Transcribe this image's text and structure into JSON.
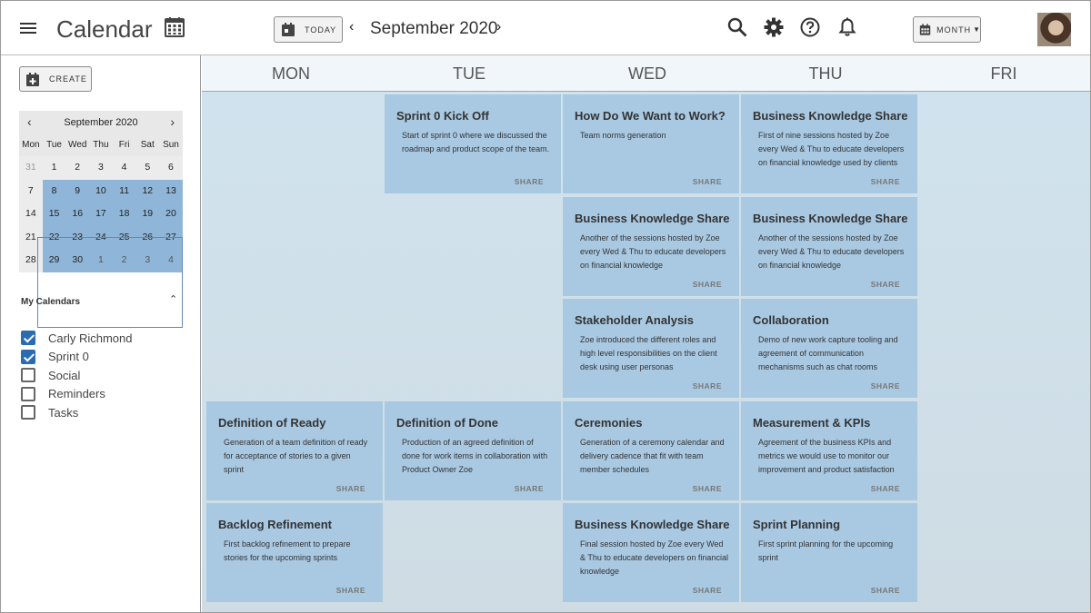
{
  "header": {
    "title": "Calendar",
    "today_label": "TODAY",
    "month_label": "September 2020",
    "view_label": "MONTH"
  },
  "sidebar": {
    "create_label": "CREATE",
    "mini_calendar": {
      "title": "September 2020",
      "dow": [
        "Mon",
        "Tue",
        "Wed",
        "Thu",
        "Fri",
        "Sat",
        "Sun"
      ],
      "weeks": [
        [
          "31",
          "1",
          "2",
          "3",
          "4",
          "5",
          "6"
        ],
        [
          "7",
          "8",
          "9",
          "10",
          "11",
          "12",
          "13"
        ],
        [
          "14",
          "15",
          "16",
          "17",
          "18",
          "19",
          "20"
        ],
        [
          "21",
          "22",
          "23",
          "24",
          "25",
          "26",
          "27"
        ],
        [
          "28",
          "29",
          "30",
          "1",
          "2",
          "3",
          "4"
        ]
      ]
    },
    "my_calendars_title": "My Calendars",
    "calendars": [
      {
        "name": "Carly Richmond",
        "checked": true
      },
      {
        "name": "Sprint 0",
        "checked": true
      },
      {
        "name": "Social",
        "checked": false
      },
      {
        "name": "Reminders",
        "checked": false
      },
      {
        "name": "Tasks",
        "checked": false
      }
    ]
  },
  "main": {
    "days": [
      "MON",
      "TUE",
      "WED",
      "THU",
      "FRI"
    ],
    "share_label": "SHARE",
    "events": [
      {
        "title": "Sprint 0 Kick Off",
        "desc": "Start of sprint 0 where we discussed the roadmap and product scope of the team.",
        "col": 1,
        "row": 0
      },
      {
        "title": "How Do We Want to Work?",
        "desc": "Team norms generation",
        "col": 2,
        "row": 0
      },
      {
        "title": "Business Knowledge Share",
        "desc": "First of nine sessions hosted by Zoe every Wed & Thu to educate developers on financial knowledge used by clients",
        "col": 3,
        "row": 0
      },
      {
        "title": "Business Knowledge Share",
        "desc": "Another of the sessions hosted by Zoe every Wed & Thu to educate developers on financial knowledge",
        "col": 2,
        "row": 1
      },
      {
        "title": "Business Knowledge Share",
        "desc": "Another of the sessions hosted by Zoe every Wed & Thu to educate developers on financial knowledge",
        "col": 3,
        "row": 1
      },
      {
        "title": "Stakeholder Analysis",
        "desc": "Zoe introduced the different roles and high level responsibilities on the client desk using user personas",
        "col": 2,
        "row": 2
      },
      {
        "title": "Collaboration",
        "desc": "Demo of new work capture tooling and agreement of communication mechanisms such as chat rooms",
        "col": 3,
        "row": 2
      },
      {
        "title": "Definition of Ready",
        "desc": "Generation of a team definition of ready for acceptance of stories to a given sprint",
        "col": 0,
        "row": 3
      },
      {
        "title": "Definition of Done",
        "desc": "Production of an agreed definition of done for work items in collaboration with Product Owner Zoe",
        "col": 1,
        "row": 3
      },
      {
        "title": "Ceremonies",
        "desc": "Generation of a ceremony calendar and delivery cadence that fit with team member schedules",
        "col": 2,
        "row": 3
      },
      {
        "title": "Measurement & KPIs",
        "desc": "Agreement of the business KPIs and metrics we would use to monitor our improvement and product satisfaction",
        "col": 3,
        "row": 3
      },
      {
        "title": "Backlog Refinement",
        "desc": "First backlog refinement to prepare stories for the upcoming sprints",
        "col": 0,
        "row": 4
      },
      {
        "title": "Business Knowledge Share",
        "desc": "Final session hosted by Zoe every Wed & Thu to educate developers on financial knowledge",
        "col": 2,
        "row": 4
      },
      {
        "title": "Sprint Planning",
        "desc": "First sprint planning for the upcoming sprint",
        "col": 3,
        "row": 4
      }
    ]
  }
}
